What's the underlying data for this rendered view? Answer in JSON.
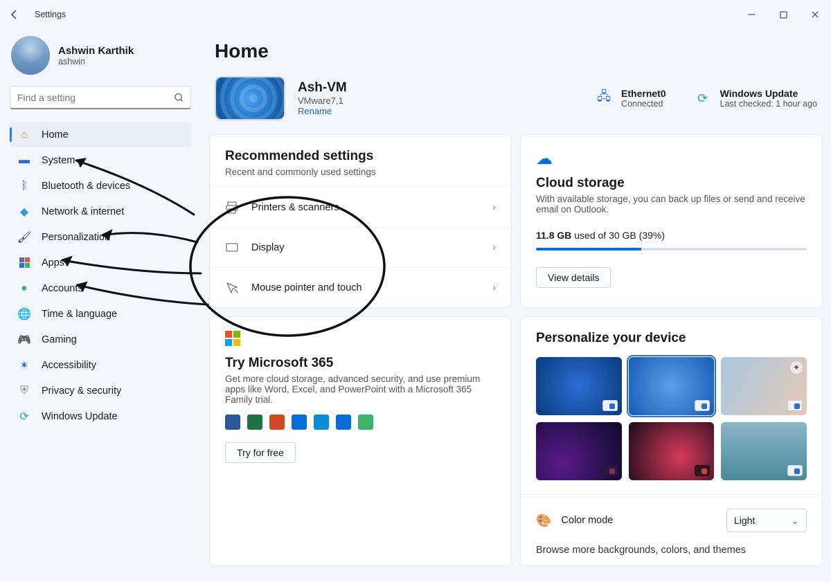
{
  "window": {
    "title": "Settings"
  },
  "profile": {
    "name": "Ashwin Karthik",
    "user": "ashwin"
  },
  "search": {
    "placeholder": "Find a setting"
  },
  "sidebar": {
    "items": [
      {
        "label": "Home",
        "icon": "home-icon",
        "color": "#e88a2c"
      },
      {
        "label": "System",
        "icon": "system-icon",
        "color": "#2a6ed6"
      },
      {
        "label": "Bluetooth & devices",
        "icon": "bluetooth-icon",
        "color": "#2a6ed6"
      },
      {
        "label": "Network & internet",
        "icon": "wifi-icon",
        "color": "#2a6ed6"
      },
      {
        "label": "Personalization",
        "icon": "brush-icon",
        "color": "#c75c5c"
      },
      {
        "label": "Apps",
        "icon": "apps-icon",
        "color": "#6a6a9a"
      },
      {
        "label": "Accounts",
        "icon": "person-icon",
        "color": "#47b36a"
      },
      {
        "label": "Time & language",
        "icon": "globe-icon",
        "color": "#3a9ad6"
      },
      {
        "label": "Gaming",
        "icon": "controller-icon",
        "color": "#8a8a8a"
      },
      {
        "label": "Accessibility",
        "icon": "accessibility-icon",
        "color": "#2a6ed6"
      },
      {
        "label": "Privacy & security",
        "icon": "shield-icon",
        "color": "#8a8a8a"
      },
      {
        "label": "Windows Update",
        "icon": "update-icon",
        "color": "#2a9ed6"
      }
    ]
  },
  "page": {
    "title": "Home"
  },
  "device": {
    "name": "Ash-VM",
    "model": "VMware7,1",
    "rename": "Rename"
  },
  "network": {
    "title": "Ethernet0",
    "status": "Connected"
  },
  "update": {
    "title": "Windows Update",
    "status": "Last checked: 1 hour ago"
  },
  "recommended": {
    "title": "Recommended settings",
    "subtitle": "Recent and commonly used settings",
    "items": [
      {
        "label": "Printers & scanners"
      },
      {
        "label": "Display"
      },
      {
        "label": "Mouse pointer and touch"
      }
    ]
  },
  "cloud": {
    "title": "Cloud storage",
    "subtitle": "With available storage, you can back up files or send and receive email on Outlook.",
    "used": "11.8 GB",
    "rest": " used of 30 GB (39%)",
    "percent": 39,
    "button": "View details"
  },
  "m365": {
    "title": "Try Microsoft 365",
    "subtitle": "Get more cloud storage, advanced security, and use premium apps like Word, Excel, and PowerPoint with a Microsoft 365 Family trial.",
    "button": "Try for free"
  },
  "personalize": {
    "title": "Personalize your device",
    "color_mode_label": "Color mode",
    "color_mode_value": "Light",
    "browse": "Browse more backgrounds, colors, and themes"
  }
}
